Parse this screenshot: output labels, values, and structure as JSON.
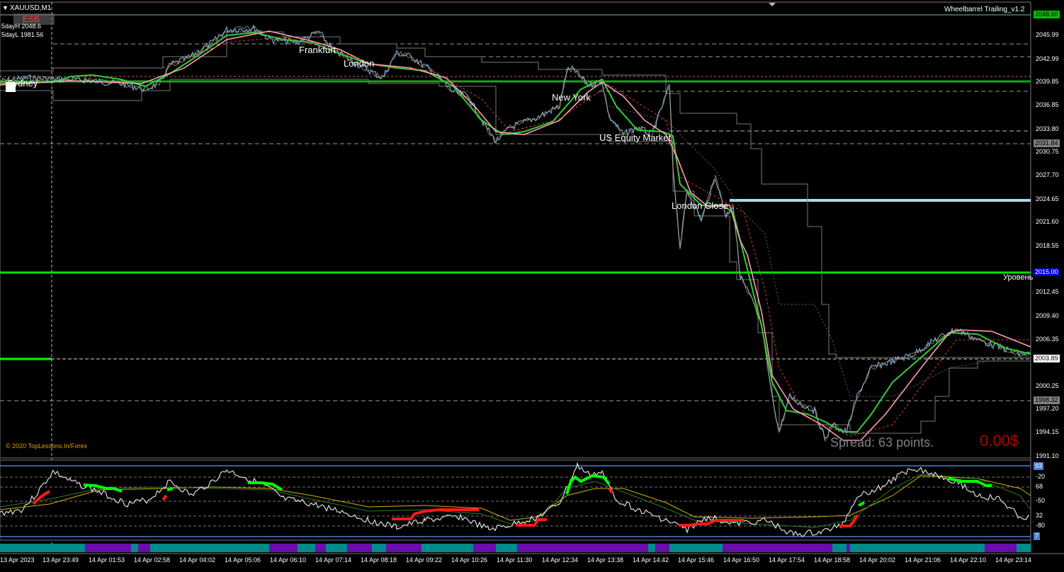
{
  "symbol": "XAUUSD,M1",
  "session_badge": "ESB",
  "five_day_high": "5dayH 2048.6",
  "five_day_low": "5dayL 1981.56",
  "indicator_title": "Wheelbarrel Trailing_v1.2",
  "copyright": "© 2020 TopLessons.In/Forex",
  "spread_text": "Spread: 63 points.",
  "profit_text": "0.00$",
  "level_label": "Уровень",
  "sessions": {
    "sydney": "Sydney",
    "frankfurt": "Frankfurt",
    "london": "London",
    "new_york": "New York",
    "us_equity": "US Equity Market",
    "london_close": "London Close"
  },
  "price_axis": {
    "ticks": [
      "2045.99",
      "2042.99",
      "2039.85",
      "2036.85",
      "2033.80",
      "2030.75",
      "2027.70",
      "2024.65",
      "2021.60",
      "2018.55",
      "2012.45",
      "2009.40",
      "2006.35",
      "2000.25",
      "1997.20",
      "1994.15",
      "1991.10"
    ],
    "tags": {
      "top": "2048.60",
      "mid1": "2031.84",
      "blue": "2015.00",
      "bid": "2003.89",
      "low": "1998.32"
    }
  },
  "osc_axis": {
    "ticks": [
      "-20",
      "68",
      "-50",
      "32",
      "-80"
    ],
    "top": "93",
    "bottom": "7"
  },
  "time_axis": [
    "13 Apr 2023",
    "13 Apr 23:49",
    "14 Apr 01:53",
    "14 Apr 02:58",
    "14 Apr 04:02",
    "14 Apr 05:06",
    "14 Apr 06:10",
    "14 Apr 07:14",
    "14 Apr 08:18",
    "14 Apr 09:22",
    "14 Apr 10:26",
    "14 Apr 11:30",
    "14 Apr 12:34",
    "14 Apr 13:38",
    "14 Apr 14:42",
    "14 Apr 15:46",
    "14 Apr 16:50",
    "14 Apr 17:54",
    "14 Apr 18:58",
    "14 Apr 20:02",
    "14 Apr 21:06",
    "14 Apr 22:10",
    "14 Apr 23:14"
  ],
  "colors": {
    "background": "#000000",
    "price_line": "#6f9fd8",
    "fast_ma": "#32cd32",
    "slow_ma": "#ff9eb5",
    "level_green": "#00c000",
    "level_blue": "#add8e6",
    "bull": "#00ff00",
    "bear": "#ff0000",
    "teal": "#008b8b",
    "purple": "#6a0dad"
  }
}
